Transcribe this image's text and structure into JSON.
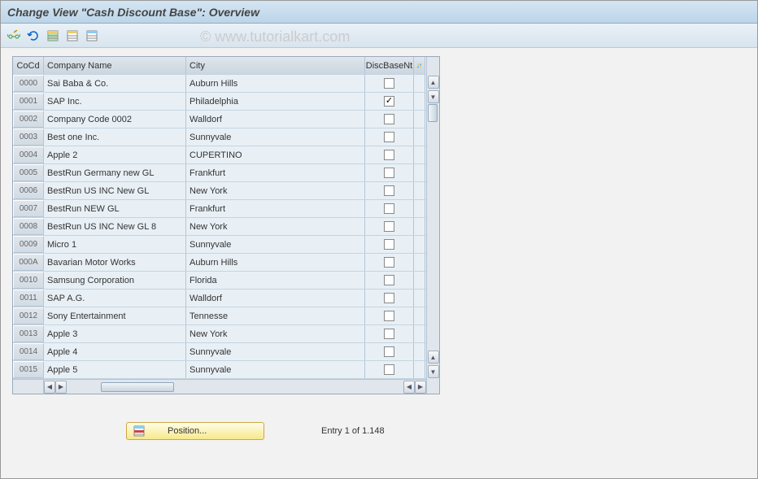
{
  "title": "Change View \"Cash Discount Base\": Overview",
  "watermark": "© www.tutorialkart.com",
  "columns": {
    "cocd": "CoCd",
    "name": "Company Name",
    "city": "City",
    "disc": "DiscBaseNt"
  },
  "rows": [
    {
      "cocd": "0000",
      "name": "Sai Baba & Co.",
      "city": "Auburn Hills",
      "disc": false
    },
    {
      "cocd": "0001",
      "name": "SAP Inc.",
      "city": "Philadelphia",
      "disc": true
    },
    {
      "cocd": "0002",
      "name": "Company Code 0002",
      "city": "Walldorf",
      "disc": false
    },
    {
      "cocd": "0003",
      "name": "Best one Inc.",
      "city": "Sunnyvale",
      "disc": false
    },
    {
      "cocd": "0004",
      "name": "Apple 2",
      "city": "CUPERTINO",
      "disc": false
    },
    {
      "cocd": "0005",
      "name": "BestRun Germany new GL",
      "city": "Frankfurt",
      "disc": false
    },
    {
      "cocd": "0006",
      "name": "BestRun US INC New GL",
      "city": "New York",
      "disc": false
    },
    {
      "cocd": "0007",
      "name": "BestRun NEW GL",
      "city": "Frankfurt",
      "disc": false
    },
    {
      "cocd": "0008",
      "name": "BestRun US INC New GL 8",
      "city": "New York",
      "disc": false
    },
    {
      "cocd": "0009",
      "name": "Micro 1",
      "city": "Sunnyvale",
      "disc": false
    },
    {
      "cocd": "000A",
      "name": "Bavarian Motor Works",
      "city": "Auburn Hills",
      "disc": false
    },
    {
      "cocd": "0010",
      "name": "Samsung Corporation",
      "city": "Florida",
      "disc": false
    },
    {
      "cocd": "0011",
      "name": "SAP A.G.",
      "city": "Walldorf",
      "disc": false
    },
    {
      "cocd": "0012",
      "name": "Sony Entertainment",
      "city": "Tennesse",
      "disc": false
    },
    {
      "cocd": "0013",
      "name": "Apple 3",
      "city": "New York",
      "disc": false
    },
    {
      "cocd": "0014",
      "name": "Apple 4",
      "city": "Sunnyvale",
      "disc": false
    },
    {
      "cocd": "0015",
      "name": "Apple 5",
      "city": "Sunnyvale",
      "disc": false
    }
  ],
  "footer": {
    "position_label": "Position...",
    "entry_text": "Entry 1 of 1.148"
  }
}
